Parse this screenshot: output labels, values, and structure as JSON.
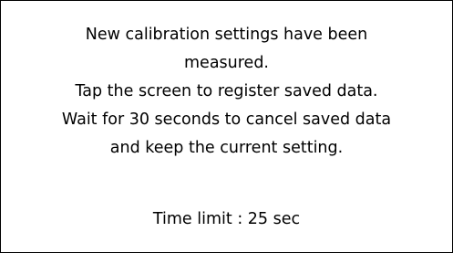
{
  "dialog": {
    "message_lines": [
      "New calibration settings have been",
      "measured.",
      "Tap the screen to register saved data.",
      "Wait for 30 seconds to cancel saved data",
      "and keep the current setting."
    ],
    "time_limit": "Time limit : 25 sec"
  },
  "colors": {
    "background": "#ffffff",
    "border": "#000000",
    "text": "#000000"
  }
}
